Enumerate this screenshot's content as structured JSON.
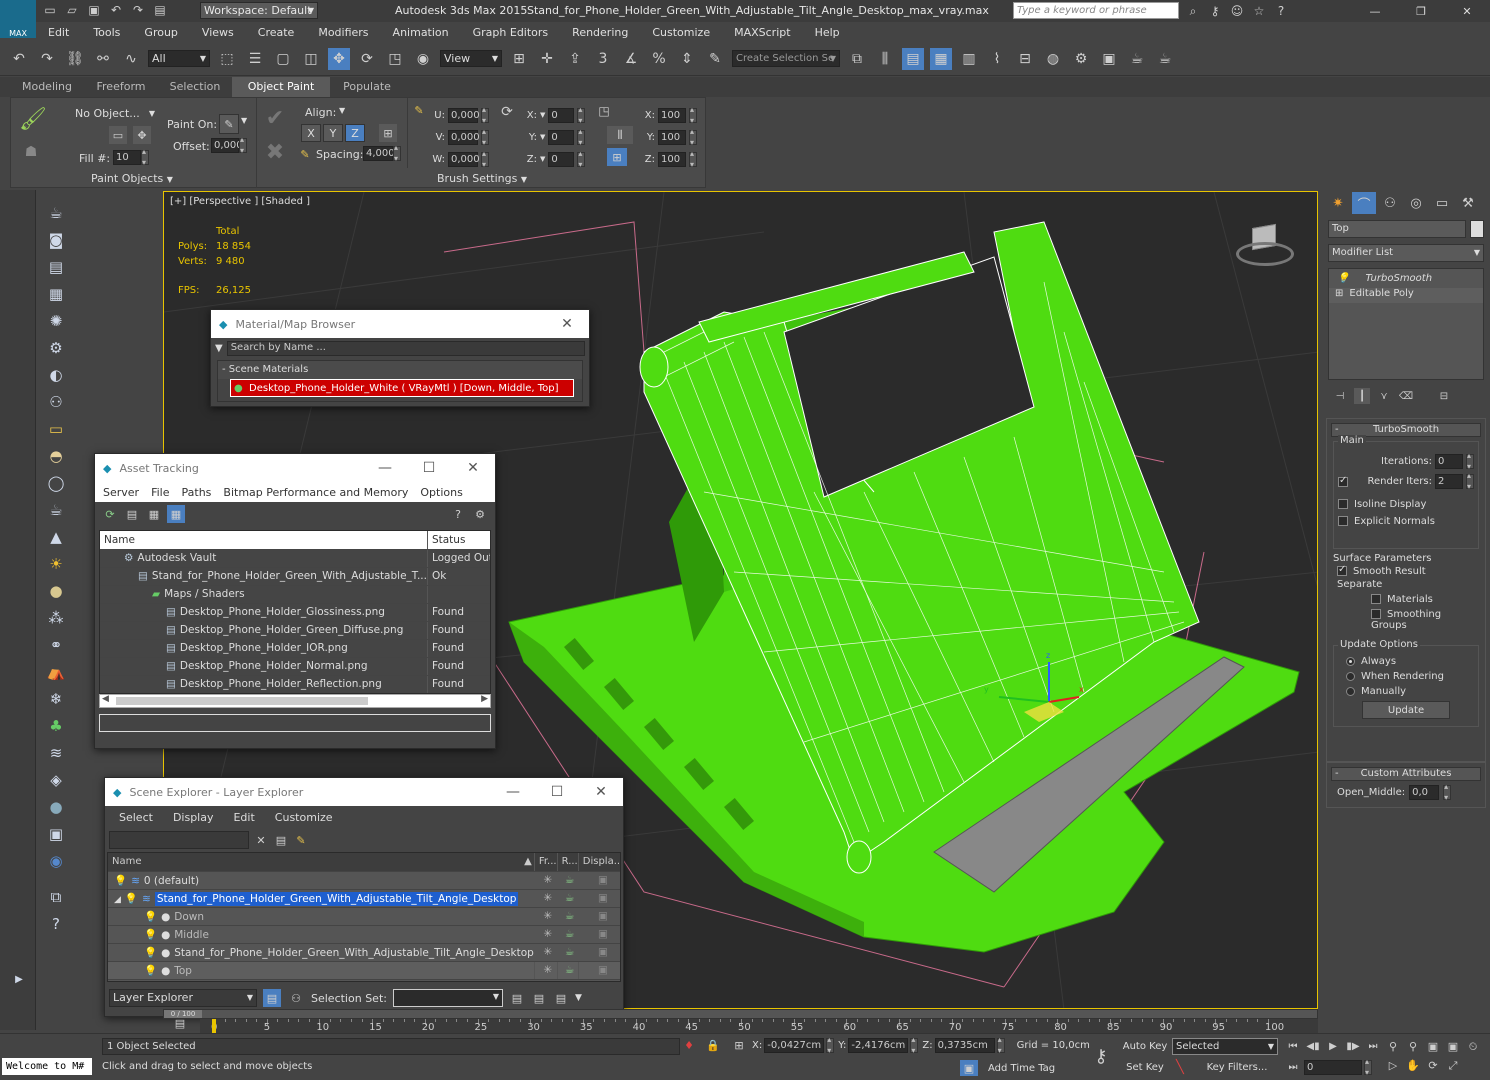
{
  "titlebar": {
    "workspace": "Workspace: Default",
    "app": "Autodesk 3ds Max  2015",
    "file": "Stand_for_Phone_Holder_Green_With_Adjustable_Tilt_Angle_Desktop_max_vray.max",
    "search_placeholder": "Type a keyword or phrase",
    "logo": "MAX"
  },
  "menubar": [
    "Edit",
    "Tools",
    "Group",
    "Views",
    "Create",
    "Modifiers",
    "Animation",
    "Graph Editors",
    "Rendering",
    "Customize",
    "MAXScript",
    "Help"
  ],
  "toolbar": {
    "selection_filter": "All",
    "ref_coord": "View",
    "selection_set": "Create Selection Se"
  },
  "ribbon": {
    "tabs": [
      "Modeling",
      "Freeform",
      "Selection",
      "Object Paint",
      "Populate"
    ],
    "active": "Object Paint",
    "no_object": "No Object...",
    "paint_on": "Paint On:",
    "offset_label": "Offset:",
    "offset": "0,000",
    "fill_label": "Fill #:",
    "fill": "10",
    "align_label": "Align:",
    "axes": [
      "X",
      "Y",
      "Z"
    ],
    "spacing_label": "Spacing:",
    "spacing": "4,000",
    "uvw": [
      {
        "l": "U:",
        "v": "0,000"
      },
      {
        "l": "V:",
        "v": "0,000"
      },
      {
        "l": "W:",
        "v": "0,000"
      }
    ],
    "rot": [
      {
        "l": "X:",
        "v": "0"
      },
      {
        "l": "Y:",
        "v": "0"
      },
      {
        "l": "Z:",
        "v": "0"
      }
    ],
    "scl": [
      {
        "l": "X:",
        "v": "100"
      },
      {
        "l": "Y:",
        "v": "100"
      },
      {
        "l": "Z:",
        "v": "100"
      }
    ],
    "group_paint": "Paint Objects",
    "group_brush": "Brush Settings"
  },
  "viewport": {
    "label": "[+] [Perspective ] [Shaded ]",
    "total": "Total",
    "polys_l": "Polys:",
    "polys": "18 854",
    "verts_l": "Verts:",
    "verts": "9 480",
    "fps_l": "FPS:",
    "fps": "26,125",
    "bg": "#2b2b2b",
    "green": "#4fdc11"
  },
  "material_browser": {
    "title": "Material/Map Browser",
    "search": "Search by Name ...",
    "section": "Scene Materials",
    "item": "Desktop_Phone_Holder_White  ( VRayMtl )  [Down, Middle, Top]"
  },
  "asset_tracking": {
    "title": "Asset Tracking",
    "menu": [
      "Server",
      "File",
      "Paths",
      "Bitmap Performance and Memory",
      "Options"
    ],
    "col_name": "Name",
    "col_status": "Status",
    "rows": [
      {
        "n": "Autodesk Vault",
        "s": "Logged Out ...",
        "ind": 1
      },
      {
        "n": "Stand_for_Phone_Holder_Green_With_Adjustable_T...",
        "s": "Ok",
        "ind": 2
      },
      {
        "n": "Maps / Shaders",
        "s": "",
        "ind": 3
      },
      {
        "n": "Desktop_Phone_Holder_Glossiness.png",
        "s": "Found",
        "ind": 4
      },
      {
        "n": "Desktop_Phone_Holder_Green_Diffuse.png",
        "s": "Found",
        "ind": 4
      },
      {
        "n": "Desktop_Phone_Holder_IOR.png",
        "s": "Found",
        "ind": 4
      },
      {
        "n": "Desktop_Phone_Holder_Normal.png",
        "s": "Found",
        "ind": 4
      },
      {
        "n": "Desktop_Phone_Holder_Reflection.png",
        "s": "Found",
        "ind": 4
      }
    ]
  },
  "scene_explorer": {
    "title": "Scene Explorer - Layer Explorer",
    "menu": [
      "Select",
      "Display",
      "Edit",
      "Customize"
    ],
    "col_name": "Name",
    "col_fr": "Fr...",
    "col_r": "R...",
    "col_disp": "Displa...",
    "rows": [
      {
        "n": "0 (default)",
        "ind": 0,
        "sel": false
      },
      {
        "n": "Stand_for_Phone_Holder_Green_With_Adjustable_Tilt_Angle_Desktop",
        "ind": 0,
        "sel": true
      },
      {
        "n": "Down",
        "ind": 1,
        "sel": false
      },
      {
        "n": "Middle",
        "ind": 1,
        "sel": false
      },
      {
        "n": "Stand_for_Phone_Holder_Green_With_Adjustable_Tilt_Angle_Desktop",
        "ind": 1,
        "sel": false
      },
      {
        "n": "Top",
        "ind": 1,
        "sel": false
      }
    ],
    "footer_mode": "Layer Explorer",
    "footer_selset": "Selection Set:"
  },
  "cmdpanel": {
    "name": "Top",
    "modifier_list": "Modifier List",
    "stack": [
      "TurboSmooth",
      "Editable Poly"
    ],
    "turbosmooth": "TurboSmooth",
    "main": "Main",
    "iterations_l": "Iterations:",
    "iterations": "0",
    "render_iters_l": "Render Iters:",
    "render_iters": "2",
    "isoline": "Isoline Display",
    "explicit": "Explicit Normals",
    "surface": "Surface Parameters",
    "smooth_result": "Smooth Result",
    "separate": "Separate",
    "materials": "Materials",
    "smoothing": "Smoothing Groups",
    "update_opts": "Update Options",
    "always": "Always",
    "when_render": "When Rendering",
    "manually": "Manually",
    "update": "Update",
    "custom_attr": "Custom Attributes",
    "open_middle_l": "Open_Middle:",
    "open_middle": "0,0"
  },
  "timeline": {
    "frame": "0 / 100",
    "ticks": [
      "0",
      "5",
      "10",
      "15",
      "20",
      "25",
      "30",
      "35",
      "40",
      "45",
      "50",
      "55",
      "60",
      "65",
      "70",
      "75",
      "80",
      "85",
      "90",
      "95",
      "100"
    ]
  },
  "status": {
    "selected": "1 Object Selected",
    "prompt": "Click and drag to select and move objects",
    "welcome": "Welcome to M#",
    "x_l": "X:",
    "x": "-0,0427cm",
    "y_l": "Y:",
    "y": "-2,4176cm",
    "z_l": "Z:",
    "z": "0,3735cm",
    "grid": "Grid = 10,0cm",
    "add_time_tag": "Add Time Tag",
    "auto_key": "Auto Key",
    "set_key": "Set Key",
    "key_mode": "Selected",
    "key_filters": "Key Filters...",
    "frame": "0"
  }
}
